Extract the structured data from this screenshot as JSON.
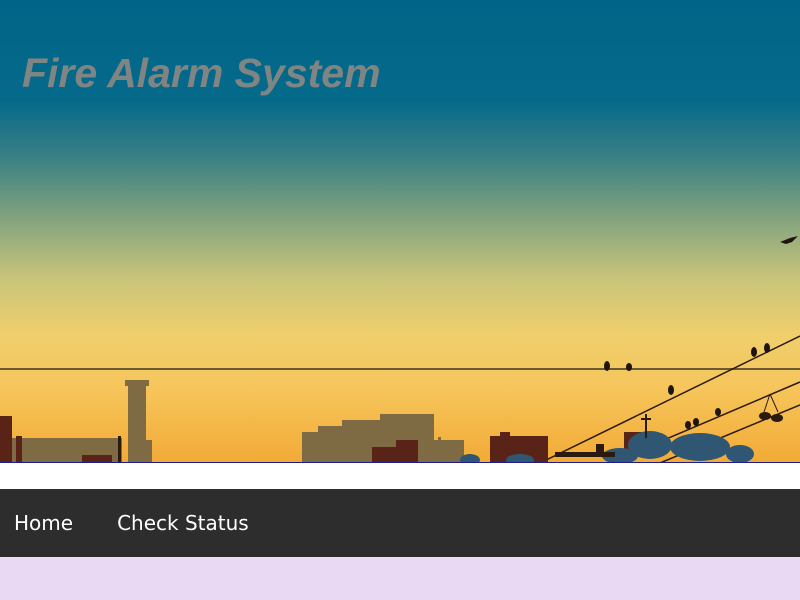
{
  "header": {
    "title": "Fire Alarm System",
    "banner_image": "city-skyline-sunset-illustration"
  },
  "nav": {
    "items": [
      {
        "label": "Home"
      },
      {
        "label": "Check Status"
      }
    ]
  },
  "colors": {
    "sky_top": "#006488",
    "sky_bottom": "#f2aa36",
    "title_text": "#7f8583",
    "nav_background": "#2d2d2d",
    "nav_text": "#ffffff",
    "content_background": "#ead9f3"
  }
}
